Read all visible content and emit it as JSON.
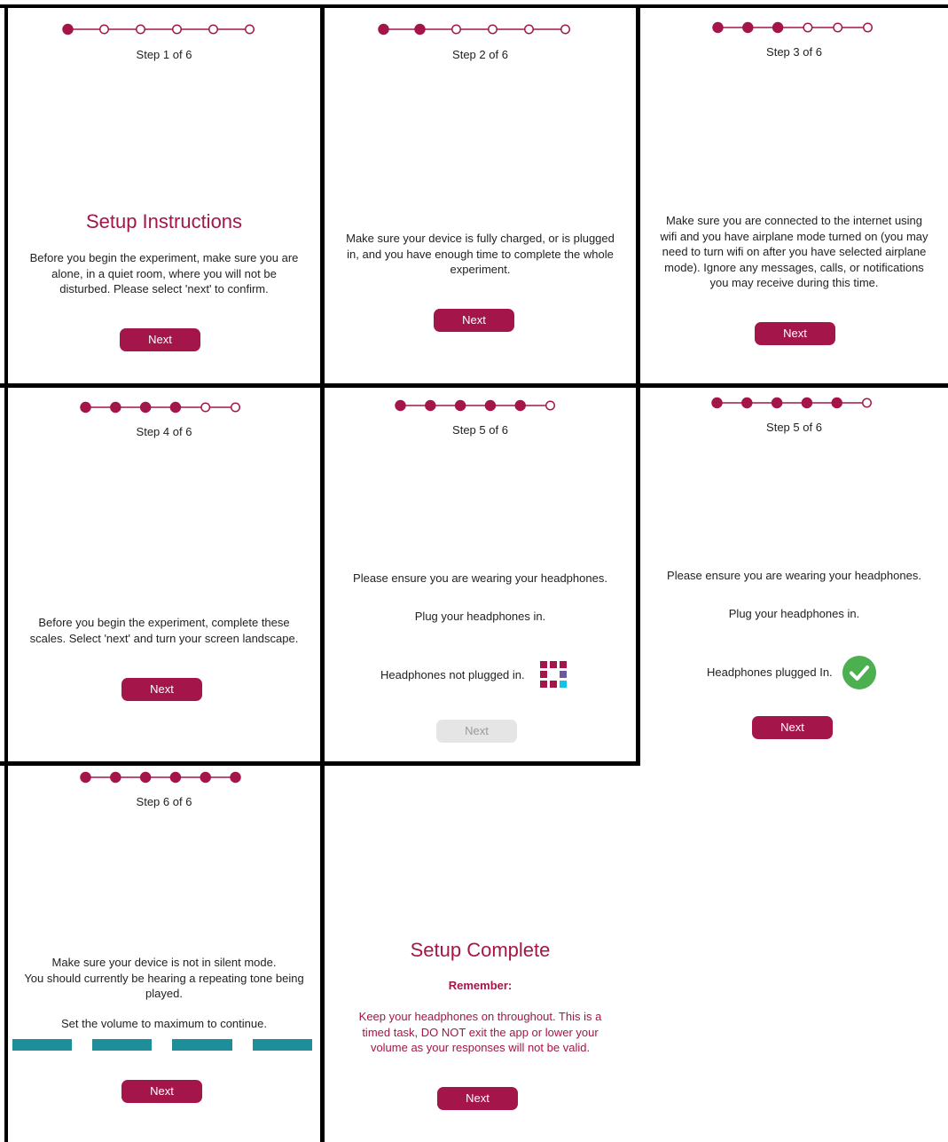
{
  "colors": {
    "accent": "#a4154a",
    "disabled_button": "#e5e5e5",
    "check_green": "#4caf50",
    "volume_bar": "#1e8f9a",
    "spinner_purple": "#6b5a9e",
    "spinner_cyan": "#15c2e8"
  },
  "panels": [
    {
      "step_total": 6,
      "step_done": 1,
      "step_label": "Step 1 of 6",
      "title": "Setup Instructions",
      "lines": [
        "Before you begin the experiment, make sure you are",
        "alone, in a quiet room, where you will not be",
        "disturbed. Please select 'next' to confirm."
      ],
      "button": "Next"
    },
    {
      "step_total": 6,
      "step_done": 2,
      "step_label": "Step 2 of 6",
      "lines": [
        "Make sure your device is fully charged, or is plugged",
        "in, and you have enough time to complete the whole",
        "experiment."
      ],
      "button": "Next"
    },
    {
      "step_total": 6,
      "step_done": 3,
      "step_label": "Step 3 of 6",
      "lines": [
        "Make sure you are connected to the internet using",
        "wifi and you have airplane mode turned on (you may",
        "need to turn wifi on after you have selected airplane",
        "mode). Ignore any messages, calls, or notifications",
        "you may receive during this time."
      ],
      "button": "Next"
    },
    {
      "step_total": 6,
      "step_done": 4,
      "step_label": "Step 4 of 6",
      "lines": [
        "Before you begin the experiment, complete these",
        "scales. Select 'next' and turn your screen landscape."
      ],
      "button": "Next"
    },
    {
      "step_total": 6,
      "step_done": 5,
      "step_label": "Step 5 of 6",
      "instruction": "Please ensure you are wearing your headphones.",
      "plug": "Plug your headphones in.",
      "status": "Headphones not plugged in.",
      "status_icon": "loading-spinner-icon",
      "button": "Next",
      "button_disabled": true
    },
    {
      "step_total": 6,
      "step_done": 5,
      "step_label": "Step 5 of 6",
      "instruction": "Please ensure you are wearing your headphones.",
      "plug": "Plug your headphones in.",
      "status": "Headphones plugged In.",
      "status_icon": "check-circle-icon",
      "button": "Next"
    },
    {
      "step_total": 6,
      "step_done": 6,
      "step_label": "Step 6 of 6",
      "lines": [
        "Make sure your device is not in silent mode.",
        "You should currently be hearing a repeating tone being",
        "played."
      ],
      "volume_text": "Set the volume to maximum to continue.",
      "volume_segments": 4,
      "button": "Next"
    },
    {
      "title": "Setup Complete",
      "remember": "Remember:",
      "note_lines": [
        "Keep your headphones on throughout. This is a",
        "timed task, DO NOT exit the app or lower your",
        "volume as your responses will not be valid."
      ],
      "button": "Next"
    }
  ]
}
